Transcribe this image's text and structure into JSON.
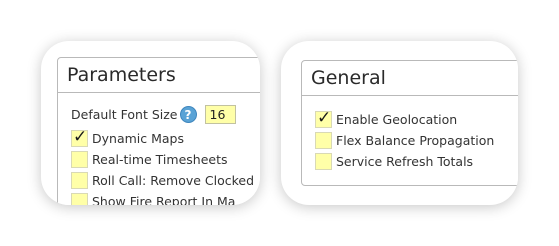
{
  "parameters": {
    "title": "Parameters",
    "font_size_label": "Default Font Size",
    "font_size_value": "16",
    "items": [
      {
        "label": "Dynamic Maps",
        "checked": true,
        "check_glyph": "✓"
      },
      {
        "label": "Real-time Timesheets",
        "checked": false,
        "check_glyph": ""
      },
      {
        "label": "Roll Call: Remove Clocked",
        "checked": false,
        "check_glyph": ""
      },
      {
        "label": "Show Fire Report In Ma",
        "checked": false,
        "check_glyph": ""
      }
    ]
  },
  "general": {
    "title": "General",
    "items": [
      {
        "label": "Enable Geolocation",
        "checked": true,
        "check_glyph": "✓"
      },
      {
        "label": "Flex Balance Propagation",
        "checked": false,
        "check_glyph": ""
      },
      {
        "label": "Service Refresh Totals",
        "checked": false,
        "check_glyph": ""
      }
    ]
  },
  "icons": {
    "help": "?"
  },
  "colors": {
    "checkbox_fill": "#ffffa8",
    "help_icon": "#5aa3d6",
    "panel_border": "#b9b9b9"
  }
}
